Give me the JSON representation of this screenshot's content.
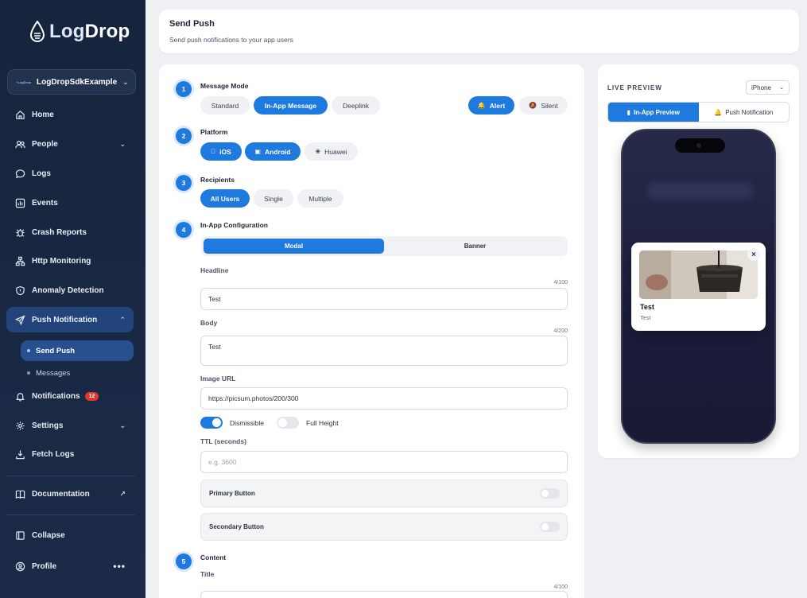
{
  "brand": {
    "name_part1": "Log",
    "name_part2": "Drop",
    "accent": "#1f7ae0"
  },
  "app_selector": {
    "value": "LogDropSdkExample",
    "logo_text": "~LogDrop"
  },
  "sidebar": {
    "items": [
      {
        "label": "Home",
        "icon": "home-icon"
      },
      {
        "label": "People",
        "icon": "people-icon"
      },
      {
        "label": "Logs",
        "icon": "chat-icon"
      },
      {
        "label": "Events",
        "icon": "chart-icon"
      },
      {
        "label": "Crash Reports",
        "icon": "bug-icon"
      },
      {
        "label": "Http Monitoring",
        "icon": "network-icon"
      },
      {
        "label": "Anomaly Detection",
        "icon": "shield-icon"
      },
      {
        "label": "Push Notification",
        "icon": "send-icon"
      },
      {
        "label": "Notifications",
        "icon": "bell-icon",
        "badge": "12"
      },
      {
        "label": "Settings",
        "icon": "gear-icon"
      },
      {
        "label": "Fetch Logs",
        "icon": "fetch-icon"
      },
      {
        "label": "Documentation",
        "icon": "book-icon"
      },
      {
        "label": "Collapse",
        "icon": "collapse-icon"
      },
      {
        "label": "Profile",
        "icon": "user-icon"
      }
    ],
    "sub_items": [
      {
        "label": "Send Push"
      },
      {
        "label": "Messages"
      }
    ]
  },
  "header": {
    "title": "Send Push",
    "subtitle": "Send push notifications to your app users"
  },
  "form": {
    "steps": [
      "1",
      "2",
      "3",
      "4",
      "5"
    ],
    "message_mode": {
      "title": "Message Mode",
      "options": [
        "Standard",
        "In-App Message",
        "Deeplink"
      ],
      "selected": "In-App Message",
      "alert_label": "Alert",
      "silent_label": "Silent"
    },
    "platform": {
      "title": "Platform",
      "options": [
        "iOS",
        "Android",
        "Huawei"
      ]
    },
    "recipients": {
      "title": "Recipients",
      "options": [
        "All Users",
        "Single",
        "Multiple"
      ]
    },
    "inapp": {
      "title": "In-App Configuration",
      "types": [
        "Modal",
        "Banner"
      ],
      "headline_label": "Headline",
      "headline_counter": "4/100",
      "headline_value": "Test",
      "body_label": "Body",
      "body_counter": "4/200",
      "body_value": "Test",
      "image_label": "Image URL",
      "image_value": "https://picsum.photos/200/300",
      "dismissible_label": "Dismissible",
      "fullheight_label": "Full Height",
      "ttl_label": "TTL (seconds)",
      "ttl_placeholder": "e.g. 3600",
      "primary_button_label": "Primary Button",
      "secondary_button_label": "Secondary Button"
    },
    "content": {
      "title": "Content",
      "title_label": "Title",
      "title_counter": "4/100"
    }
  },
  "preview": {
    "label": "LIVE PREVIEW",
    "device": "iPhone",
    "tabs": [
      "In-App Preview",
      "Push Notification"
    ],
    "modal_title": "Test",
    "modal_body": "Test"
  }
}
